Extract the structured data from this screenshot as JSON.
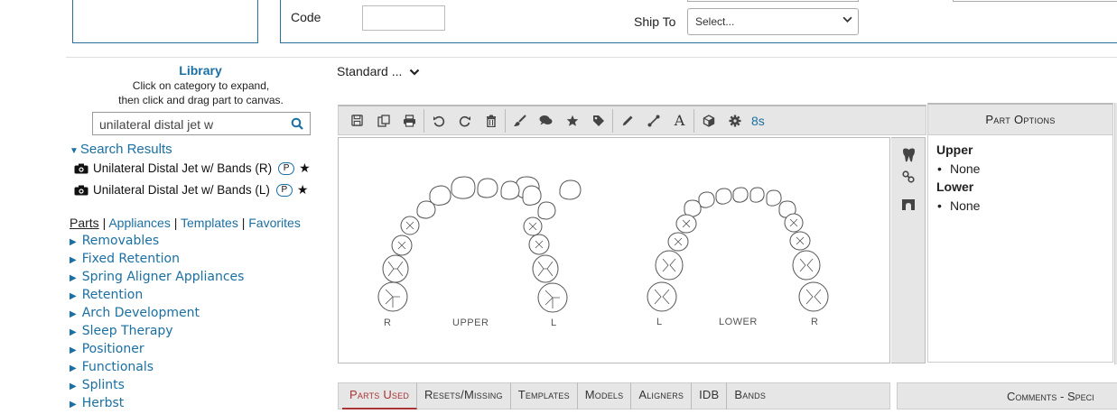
{
  "order_form": {
    "code_label": "Code",
    "code_value": "",
    "ship_to_label": "Ship To",
    "ship_to_value": "Select..."
  },
  "library": {
    "title": "Library",
    "hint_line1": "Click on category to expand,",
    "hint_line2": "then click and drag part to canvas.",
    "search_value": "unilateral distal jet w",
    "search_results_label": "Search Results",
    "results": [
      {
        "name": "Unilateral Distal Jet w/ Bands (R)",
        "badge": "P"
      },
      {
        "name": "Unilateral Distal Jet w/ Bands (L)",
        "badge": "P"
      }
    ],
    "tabs": [
      "Parts",
      "Appliances",
      "Templates",
      "Favorites"
    ],
    "categories": [
      "Removables",
      "Fixed Retention",
      "Spring Aligner Appliances",
      "Retention",
      "Arch Development",
      "Sleep Therapy",
      "Positioner",
      "Functionals",
      "Splints",
      "Herbst"
    ]
  },
  "standard_dropdown": "Standard ...",
  "toolbar": {
    "timer": "8s",
    "buttons": [
      "save-icon",
      "copy-icon",
      "print-icon",
      "undo-icon",
      "redo-icon",
      "trash-icon",
      "brush-icon",
      "comment-icon",
      "star-icon",
      "tag-icon",
      "pencil-icon",
      "line-icon",
      "text-icon",
      "cube-icon",
      "gear-icon"
    ]
  },
  "canvas": {
    "upper": {
      "label": "UPPER",
      "left_side": "R",
      "right_side": "L"
    },
    "lower": {
      "label": "LOWER",
      "left_side": "L",
      "right_side": "R"
    }
  },
  "part_options": {
    "title": "Part Options",
    "upper_label": "Upper",
    "upper_value": "None",
    "lower_label": "Lower",
    "lower_value": "None"
  },
  "bottom_tabs": [
    "Parts Used",
    "Resets/Missing",
    "Templates",
    "Models",
    "Aligners",
    "IDB",
    "Bands"
  ],
  "comments_tab": "Comments - Speci"
}
